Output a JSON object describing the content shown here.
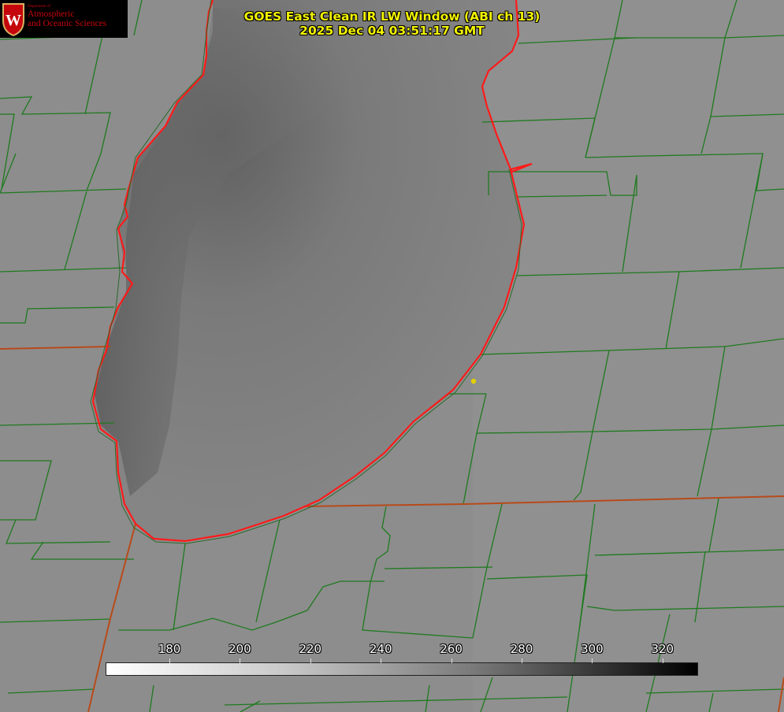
{
  "header": {
    "title_line1": "GOES East Clean IR LW Window (ABI ch 13)",
    "title_line2": "2025 Dec 04 03:51:17 GMT"
  },
  "logo": {
    "small_text": "Department of",
    "line1": "Atmospheric",
    "line2": "and Oceanic Sciences",
    "crest_letter": "W"
  },
  "colorbar": {
    "ticks": [
      "180",
      "200",
      "220",
      "240",
      "260",
      "280",
      "300",
      "320"
    ],
    "min_label": "180",
    "max_label": "320"
  },
  "colors": {
    "coast": "#ff1a1a",
    "county": "#1f7a1f",
    "state": "#b84a1a",
    "title": "#f2f200",
    "marker": "#e0d000"
  },
  "map": {
    "marker": "yellow-station-dot",
    "lake": "Lake Michigan (southern basin)"
  }
}
